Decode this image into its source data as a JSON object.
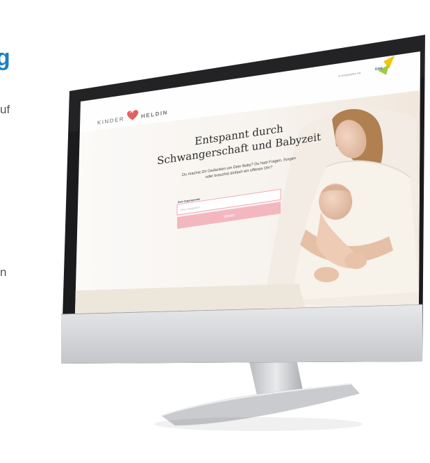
{
  "left_column": {
    "heading_fragment": "g",
    "text_fragment_1": "uf",
    "text_fragment_2": "n"
  },
  "website": {
    "logo_left": "KINDER",
    "logo_right": "HELDIN",
    "header_link": "In Kooperation mit",
    "partner_logo_text": "DAK",
    "hero_title_line1": "Entspannt durch",
    "hero_title_line2": "Schwangerschaft und Babyzeit",
    "hero_subtitle_line1": "Du machst Dir Gedanken um Dein Baby? Du hast Fragen, Sorgen",
    "hero_subtitle_line2": "oder brauchst einfach ein offenes Ohr?",
    "form_label": "Dein Zugangscode",
    "input_placeholder": "Hier eingeben",
    "submit_label": "Weiter"
  },
  "colors": {
    "accent_blue": "#1a7fc4",
    "brand_pink": "#f3b7bf",
    "partner_yellow": "#f2c400",
    "bezel": "#1b1b1d"
  }
}
